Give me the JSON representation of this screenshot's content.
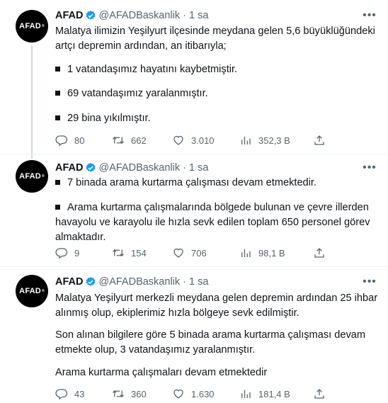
{
  "tweets": [
    {
      "author": {
        "name": "AFAD",
        "handle": "@AFADBaskanlik",
        "avatar_text": "AFAD"
      },
      "time": "1 sa",
      "lines": [
        "Malatya ilimizin Yeşilyurt ilçesinde meydana gelen 5,6 büyüklüğündeki",
        "artçı depremin ardından, an itibarıyla;"
      ],
      "bullets": [
        "1 vatandaşımız hayatını kaybetmiştir.",
        "69 vatandaşımız yaralanmıştır.",
        "29 bina yıkılmıştır."
      ],
      "stats": {
        "replies": "80",
        "retweets": "662",
        "likes": "3.010",
        "views": "352,3 B"
      }
    },
    {
      "author": {
        "name": "AFAD",
        "handle": "@AFADBaskanlik",
        "avatar_text": "AFAD"
      },
      "time": "1 sa",
      "bullet1": "7 binada arama kurtarma çalışması devam etmektedir.",
      "bullet2_lines": [
        "Arama kurtarma çalışmalarında bölgede bulunan ve çevre illerden",
        "havayolu ve karayolu ile hızla sevk edilen toplam 650 personel görev",
        "almaktadır."
      ],
      "stats": {
        "replies": "9",
        "retweets": "154",
        "likes": "706",
        "views": "98,1 B"
      }
    },
    {
      "author": {
        "name": "AFAD",
        "handle": "@AFADBaskanlik",
        "avatar_text": "AFAD"
      },
      "time": "1 sa",
      "para1": [
        "Malatya Yeşilyurt merkezli meydana gelen depremin ardından 25 ihbar",
        "alınmış olup, ekiplerimiz hızla bölgeye sevk edilmiştir."
      ],
      "para2": [
        "Son alınan bilgilere göre 5 binada arama kurtarma çalışması devam",
        "etmekte olup, 3 vatandaşımız yaralanmıştır."
      ],
      "para3": "Arama kurtarma çalışmaları devam etmektedir",
      "stats": {
        "replies": "43",
        "retweets": "360",
        "likes": "1.630",
        "views": "181,4 B"
      }
    }
  ],
  "icons": {
    "verified_color": "#1d9bf0",
    "reply": "reply-icon",
    "retweet": "retweet-icon",
    "like": "heart-icon",
    "views": "views-icon",
    "share": "share-icon",
    "more": "more-icon"
  },
  "more_glyph": "•••"
}
